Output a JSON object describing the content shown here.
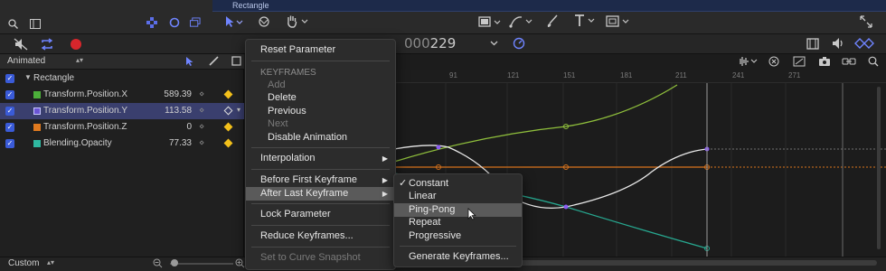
{
  "timeline": {
    "layer_name": "Rectangle"
  },
  "toolbar": {
    "timecode_prefix": "000",
    "timecode_value": "229"
  },
  "panel": {
    "filter": "Animated",
    "group": "Rectangle",
    "params": [
      {
        "name": "Transform.Position.X",
        "value": "589.39",
        "color": "#4caf3a",
        "selected": false
      },
      {
        "name": "Transform.Position.Y",
        "value": "113.58",
        "color": "#6b55d6",
        "selected": true
      },
      {
        "name": "Transform.Position.Z",
        "value": "0",
        "color": "#e07a1f",
        "selected": false
      },
      {
        "name": "Blending.Opacity",
        "value": "77.33",
        "color": "#2fb8a0",
        "selected": false
      }
    ],
    "footer_mode": "Custom"
  },
  "ruler": {
    "ticks": [
      "91",
      "121",
      "151",
      "181",
      "211",
      "241",
      "271"
    ]
  },
  "context_menu": {
    "reset": "Reset Parameter",
    "keyframes_header": "KEYFRAMES",
    "add": "Add",
    "delete": "Delete",
    "previous": "Previous",
    "next": "Next",
    "disable_animation": "Disable Animation",
    "interpolation": "Interpolation",
    "before_first": "Before First Keyframe",
    "after_last": "After Last Keyframe",
    "lock": "Lock Parameter",
    "reduce": "Reduce Keyframes...",
    "snapshot": "Set to Curve Snapshot"
  },
  "submenu": {
    "constant": "Constant",
    "linear": "Linear",
    "ping_pong": "Ping-Pong",
    "repeat": "Repeat",
    "progressive": "Progressive",
    "generate": "Generate Keyframes...",
    "checkmark": "✓"
  }
}
